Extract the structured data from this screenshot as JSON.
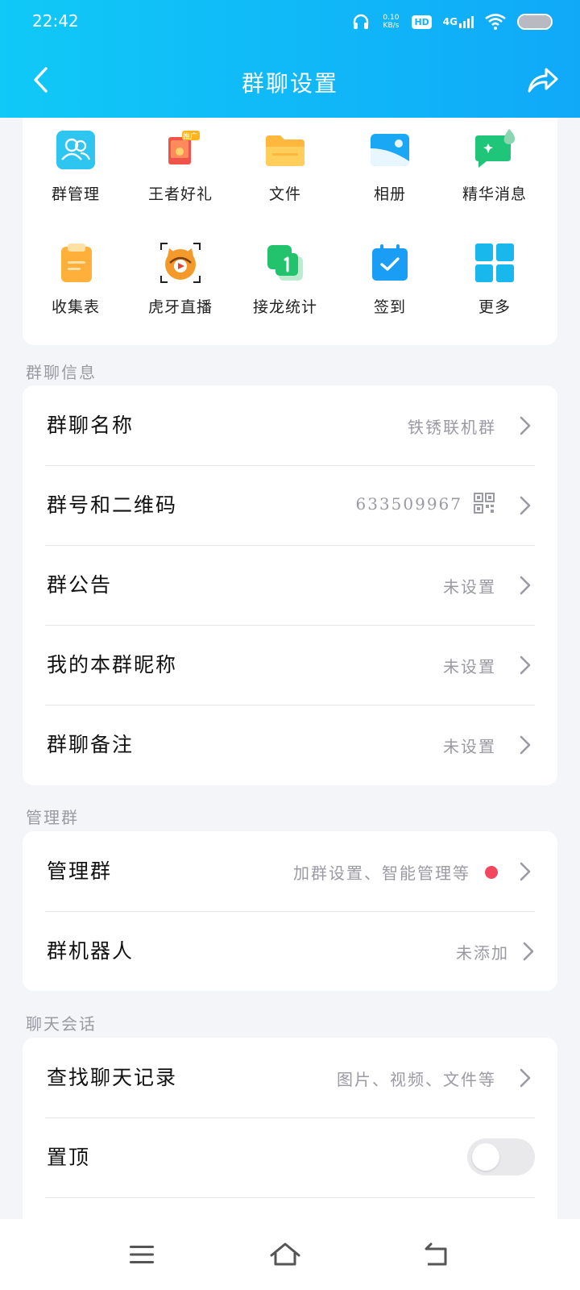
{
  "status_bar": {
    "time": "22:42",
    "net_speed_value": "0.10",
    "net_speed_unit": "KB/s",
    "hd": "HD",
    "signal": "4G",
    "battery_level_percent": 100
  },
  "header": {
    "title": "群聊设置"
  },
  "apps": [
    {
      "label": "群管理",
      "icon": "group-manage-icon",
      "color": "#2ec6f0"
    },
    {
      "label": "王者好礼",
      "icon": "gift-icon",
      "color": "#f0534a",
      "badge": "推广"
    },
    {
      "label": "文件",
      "icon": "folder-icon",
      "color": "#ffb83d"
    },
    {
      "label": "相册",
      "icon": "album-icon",
      "color": "#1aa8f4"
    },
    {
      "label": "精华消息",
      "icon": "essence-message-icon",
      "color": "#1fc67a"
    },
    {
      "label": "收集表",
      "icon": "clipboard-icon",
      "color": "#ffb03a"
    },
    {
      "label": "虎牙直播",
      "icon": "huya-live-icon",
      "color": "#f39a2b"
    },
    {
      "label": "接龙统计",
      "icon": "relay-stats-icon",
      "color": "#23c26c"
    },
    {
      "label": "签到",
      "icon": "calendar-check-icon",
      "color": "#1a9ef5"
    },
    {
      "label": "更多",
      "icon": "grid-more-icon",
      "color": "#18b8ec"
    }
  ],
  "sections": {
    "group_info": {
      "title": "群聊信息",
      "rows": [
        {
          "label": "群聊名称",
          "value": "铁锈联机群"
        },
        {
          "label": "群号和二维码",
          "value": "633509967"
        },
        {
          "label": "群公告",
          "value": "未设置"
        },
        {
          "label": "我的本群昵称",
          "value": "未设置"
        },
        {
          "label": "群聊备注",
          "value": "未设置"
        }
      ]
    },
    "manage": {
      "title": "管理群",
      "rows": [
        {
          "label": "管理群",
          "value": "加群设置、智能管理等"
        },
        {
          "label": "群机器人",
          "value": "未添加"
        }
      ]
    },
    "chat": {
      "title": "聊天会话",
      "rows": [
        {
          "label": "查找聊天记录",
          "value": "图片、视频、文件等"
        },
        {
          "label": "置顶",
          "toggle_on": false
        }
      ]
    }
  },
  "colors": {
    "header_start": "#10c9f7",
    "header_end": "#10a9f8",
    "badge_red": "#f2485f"
  }
}
